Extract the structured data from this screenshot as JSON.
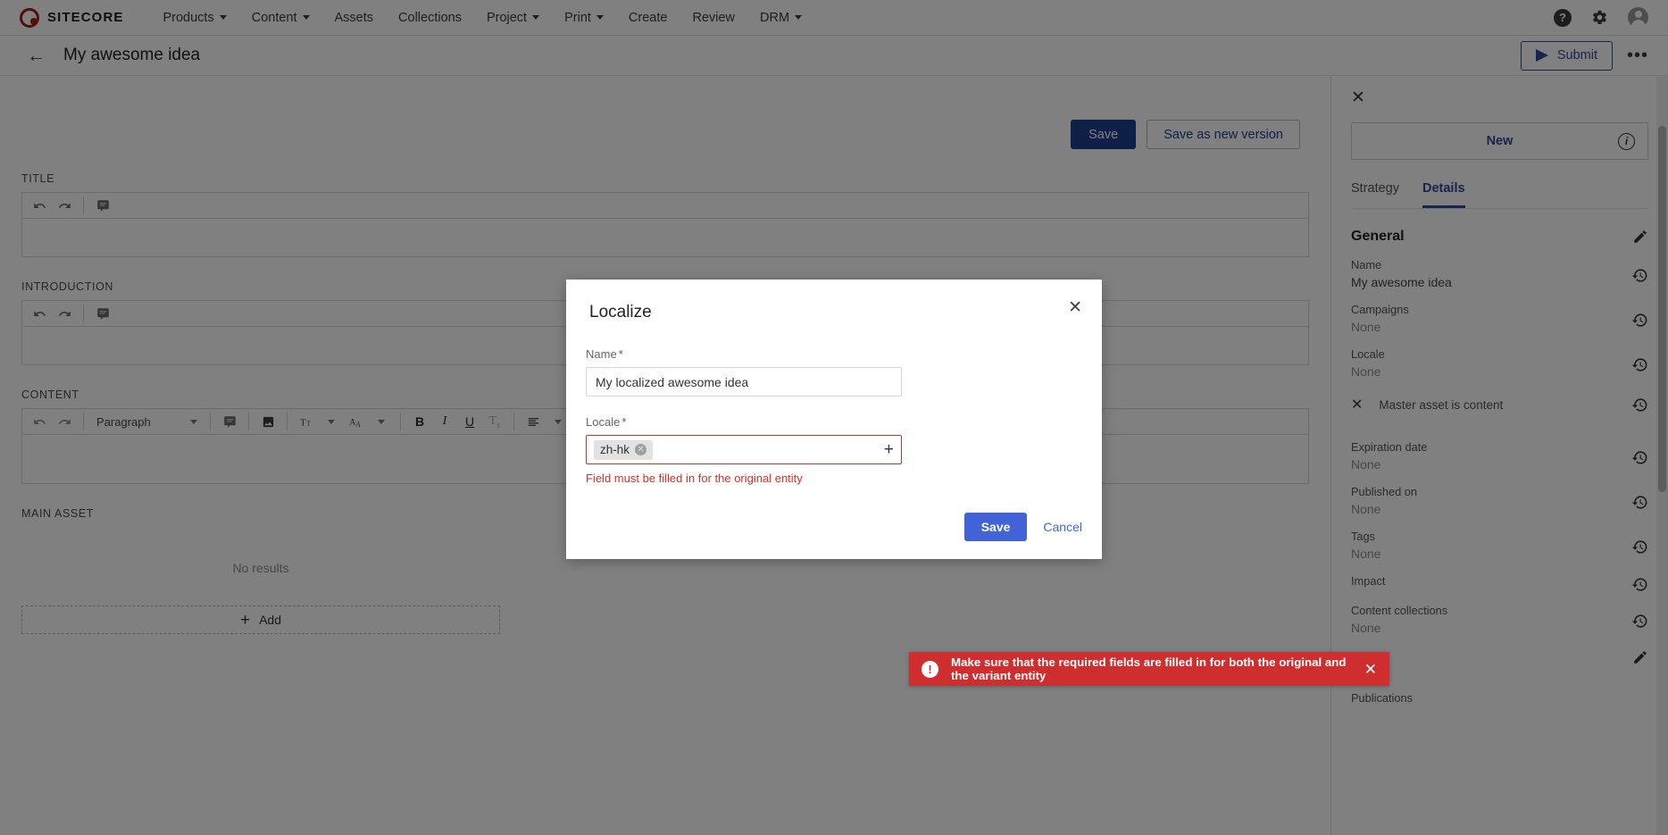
{
  "topnav": {
    "logo_text": "SITECORE",
    "items": [
      {
        "label": "Products",
        "has_caret": true
      },
      {
        "label": "Content",
        "has_caret": true
      },
      {
        "label": "Assets",
        "has_caret": false
      },
      {
        "label": "Collections",
        "has_caret": false
      },
      {
        "label": "Project",
        "has_caret": true
      },
      {
        "label": "Print",
        "has_caret": true
      },
      {
        "label": "Create",
        "has_caret": false
      },
      {
        "label": "Review",
        "has_caret": false
      },
      {
        "label": "DRM",
        "has_caret": true
      }
    ],
    "help_glyph": "?",
    "gear_glyph": "⚙"
  },
  "subheader": {
    "back_glyph": "←",
    "title": "My awesome idea",
    "submit_label": "Submit",
    "overflow_glyph": "•••"
  },
  "main": {
    "save_label": "Save",
    "save_new_version_label": "Save as new version",
    "title_section_label": "TITLE",
    "introduction_section_label": "INTRODUCTION",
    "content_section_label": "CONTENT",
    "main_asset_section_label": "MAIN ASSET",
    "main_asset_empty": "No results",
    "add_label": "Add",
    "paragraph_style": "Paragraph"
  },
  "rpanel": {
    "close_glyph": "✕",
    "status_label": "New",
    "info_glyph": "i",
    "tabs": [
      {
        "label": "Strategy",
        "active": false
      },
      {
        "label": "Details",
        "active": true
      }
    ],
    "section_title": "General",
    "properties": [
      {
        "key": "Name",
        "value": "My awesome idea"
      },
      {
        "key": "Campaigns",
        "value": "None"
      },
      {
        "key": "Locale",
        "value": "None"
      }
    ],
    "boolean_row": {
      "label": "Master asset is content",
      "glyph": "✕"
    },
    "properties2": [
      {
        "key": "Expiration date",
        "value": "None"
      },
      {
        "key": "Published on",
        "value": "None"
      },
      {
        "key": "Tags",
        "value": "None"
      },
      {
        "key": "Impact",
        "value": ""
      },
      {
        "key": "Content collections",
        "value": "None"
      }
    ],
    "publications_label": "Publications"
  },
  "modal": {
    "title": "Localize",
    "close_glyph": "✕",
    "name_label": "Name",
    "name_required": "*",
    "name_value": "My localized awesome idea",
    "name_placeholder": "",
    "locale_label": "Locale",
    "locale_required": "*",
    "locale_chip": "zh-hk",
    "chip_remove_glyph": "✕",
    "add_locale_glyph": "+",
    "error_text": "Field must be filled in for the original entity",
    "save_label": "Save",
    "cancel_label": "Cancel"
  },
  "toast": {
    "icon_glyph": "!",
    "message": "Make sure that the required fields are filled in for both the original and the variant entity",
    "close_glyph": "✕",
    "color": "#cf2e2e"
  },
  "colors": {
    "brand_red": "#a61b16",
    "accent_blue": "#2c4a9a",
    "modal_save_blue": "#4262d8",
    "error_red": "#c0392b",
    "overlay": "rgba(0,0,0,0.498)"
  }
}
